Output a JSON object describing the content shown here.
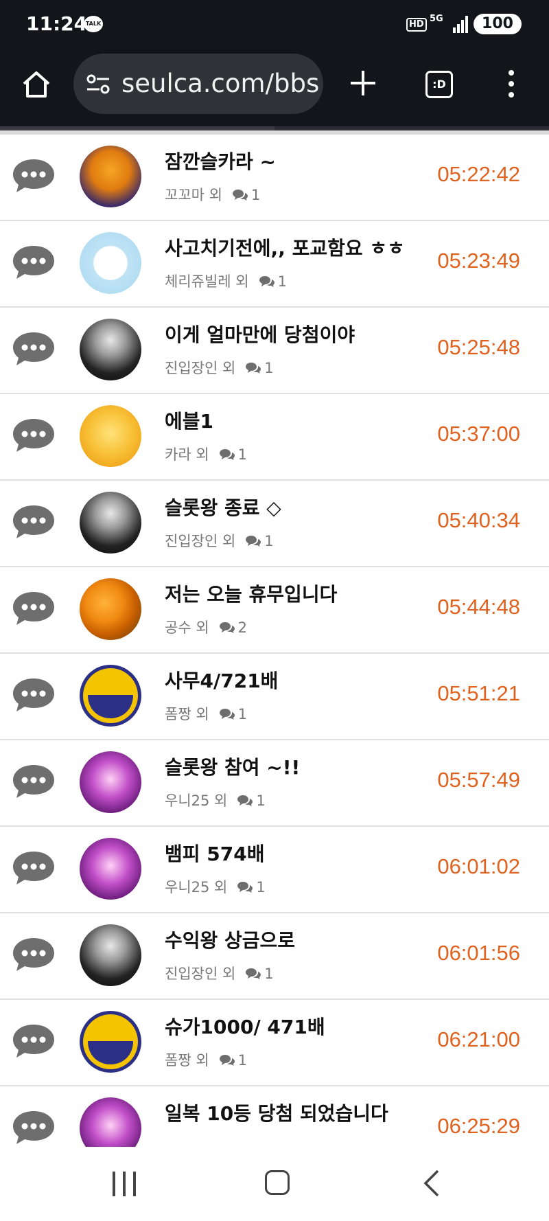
{
  "status_bar": {
    "time": "11:24",
    "talk_badge": "TALK",
    "hd_badge": "HD",
    "network": "5G",
    "battery": "100"
  },
  "browser": {
    "url": "seulca.com/bbs",
    "tabs_label": ":D",
    "page_load_progress": 0.5
  },
  "posts": [
    {
      "title": "잠깐슬카라 ~",
      "author": "꼬꼬마 외",
      "comments": "1",
      "time": "05:22:42",
      "avatar": "av-tiger"
    },
    {
      "title": "사고치기전에,, 포교함요 ㅎㅎ",
      "author": "체리쥬빌레 외",
      "comments": "1",
      "time": "05:23:49",
      "avatar": "av-kitty"
    },
    {
      "title": "이게 얼마만에 당첨이야",
      "author": "진입장인 외",
      "comments": "1",
      "time": "05:25:48",
      "avatar": "av-bw"
    },
    {
      "title": "에블1",
      "author": "카라 외",
      "comments": "1",
      "time": "05:37:00",
      "avatar": "av-cute"
    },
    {
      "title": "슬롯왕 종료 ◇",
      "author": "진입장인 외",
      "comments": "1",
      "time": "05:40:34",
      "avatar": "av-bw"
    },
    {
      "title": "저는 오늘 휴무입니다",
      "author": "공수 외",
      "comments": "2",
      "time": "05:44:48",
      "avatar": "av-orange"
    },
    {
      "title": "사무4/721배",
      "author": "폼짱 외",
      "comments": "1",
      "time": "05:51:21",
      "avatar": "av-smile"
    },
    {
      "title": "슬롯왕 참여 ~!!",
      "author": "우니25 외",
      "comments": "1",
      "time": "05:57:49",
      "avatar": "av-game"
    },
    {
      "title": "뱀피 574배",
      "author": "우니25 외",
      "comments": "1",
      "time": "06:01:02",
      "avatar": "av-game"
    },
    {
      "title": "수익왕 상금으로",
      "author": "진입장인 외",
      "comments": "1",
      "time": "06:01:56",
      "avatar": "av-bw"
    },
    {
      "title": "슈가1000/ 471배",
      "author": "폼짱 외",
      "comments": "1",
      "time": "06:21:00",
      "avatar": "av-smile"
    },
    {
      "title": "일복 10등 당첨 되었습니다",
      "author": "",
      "comments": "",
      "time": "06:25:29",
      "avatar": "av-game"
    }
  ],
  "icons": {
    "home": "home-icon",
    "site_settings": "tune-icon",
    "new_tab": "plus-icon",
    "menu": "more-vert-icon",
    "row_bubble": "chat-bubble-icon",
    "comment": "comment-icon",
    "nav_recent": "recent-apps-icon",
    "nav_home": "home-button-icon",
    "nav_back": "back-icon"
  },
  "colors": {
    "time": "#e0621f",
    "chrome_bar": "#14151a",
    "url_pill": "#303237",
    "bubble": "#6e6e6e"
  }
}
